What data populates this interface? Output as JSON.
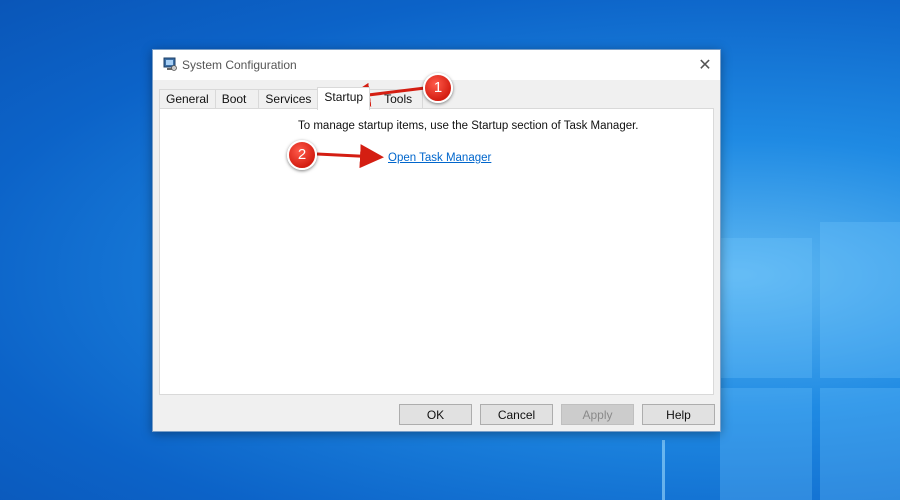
{
  "window": {
    "title": "System Configuration",
    "close_glyph": "✕",
    "icon": "msconfig-app-icon"
  },
  "tabs": [
    {
      "label": "General",
      "active": false
    },
    {
      "label": "Boot",
      "active": false
    },
    {
      "label": "Services",
      "active": false
    },
    {
      "label": "Startup",
      "active": true
    },
    {
      "label": "Tools",
      "active": false
    }
  ],
  "startup": {
    "instruction": "To manage startup items, use the Startup section of Task Manager.",
    "link_label": "Open Task Manager"
  },
  "buttons": {
    "ok": "OK",
    "cancel": "Cancel",
    "apply": "Apply",
    "help": "Help"
  },
  "annotations": [
    {
      "number": "1"
    },
    {
      "number": "2"
    }
  ],
  "colors": {
    "annotation_red": "#d41e12",
    "link_blue": "#0066cc",
    "desktop_blue": "#1f8ae3"
  }
}
